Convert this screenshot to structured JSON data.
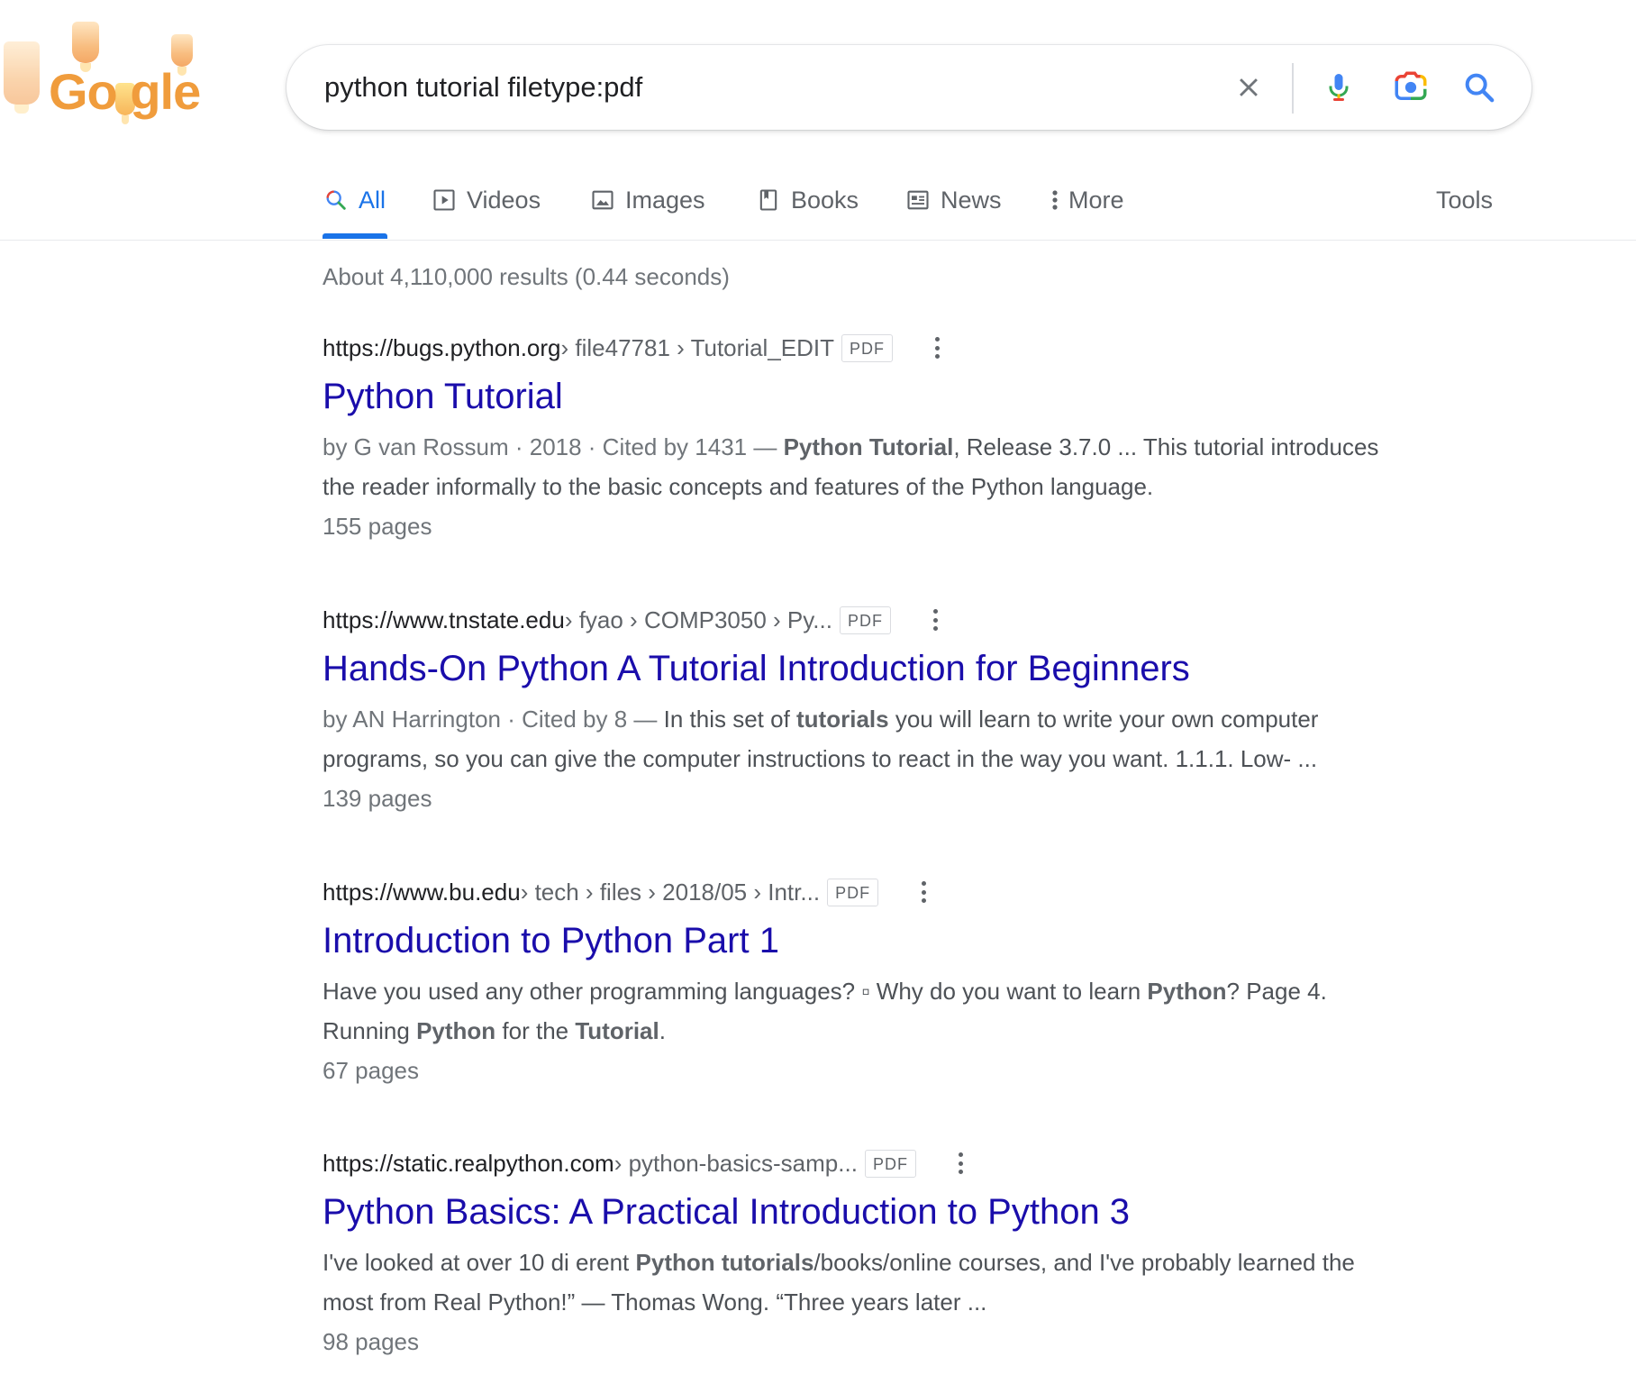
{
  "logo": {
    "text": "Go gle",
    "alt": "Google"
  },
  "search": {
    "query": "python tutorial filetype:pdf",
    "icons": [
      "close-icon",
      "microphone-icon",
      "camera-icon",
      "search-icon"
    ]
  },
  "tabs": [
    {
      "label": "All",
      "icon": "search-icon",
      "active": true
    },
    {
      "label": "Videos",
      "icon": "video-icon"
    },
    {
      "label": "Images",
      "icon": "image-icon"
    },
    {
      "label": "Books",
      "icon": "book-icon"
    },
    {
      "label": "News",
      "icon": "news-icon"
    },
    {
      "label": "More",
      "icon": "more-vertical-icon"
    }
  ],
  "tools_label": "Tools",
  "stats": "About 4,110,000 results (0.44 seconds)",
  "results": [
    {
      "domain": "https://bugs.python.org",
      "path": " › file47781 › Tutorial_EDIT",
      "badge": "PDF",
      "title": "Python Tutorial",
      "snippet": {
        "meta": "by G van Rossum · 2018 · Cited by 1431 — ",
        "b1": "Python Tutorial",
        "t1": ", Release 3.7.0 ... This tutorial introduces the reader informally to the basic concepts and features of the Python language."
      },
      "pages": "155 pages"
    },
    {
      "domain": "https://www.tnstate.edu",
      "path": " › fyao › COMP3050 › Py...",
      "badge": "PDF",
      "title": "Hands-On Python A Tutorial Introduction for Beginners",
      "snippet": {
        "meta": "by AN Harrington · Cited by 8 — ",
        "t0": "In this set of ",
        "b1": "tutorials",
        "t1": " you will learn to write your own computer programs, so you can give the computer instructions to react in the way you want. 1.1.1. Low- ..."
      },
      "pages": "139 pages"
    },
    {
      "domain": "https://www.bu.edu",
      "path": " › tech › files › 2018/05 › Intr...",
      "badge": "PDF",
      "title": "Introduction to Python Part 1",
      "snippet": {
        "t0": "Have you used any other programming languages? ▫ Why do you want to learn ",
        "b1": "Python",
        "t1": "? Page 4. Running ",
        "b2": "Python",
        "t2": " for the ",
        "b3": "Tutorial",
        "t3": "."
      },
      "pages": "67 pages"
    },
    {
      "domain": "https://static.realpython.com",
      "path": " › python-basics-samp...",
      "badge": "PDF",
      "title": "Python Basics: A Practical Introduction to Python 3",
      "snippet": {
        "t0": "I've looked at over 10 di erent ",
        "b1": "Python tutorials",
        "t1": "/books/online courses, and I've probably learned the most from Real Python!” — Thomas Wong. “Three years later ..."
      },
      "pages": "98 pages"
    }
  ],
  "colors": {
    "link": "#1a0dab",
    "accent": "#1a73e8",
    "muted": "#70757a",
    "text": "#202124"
  }
}
